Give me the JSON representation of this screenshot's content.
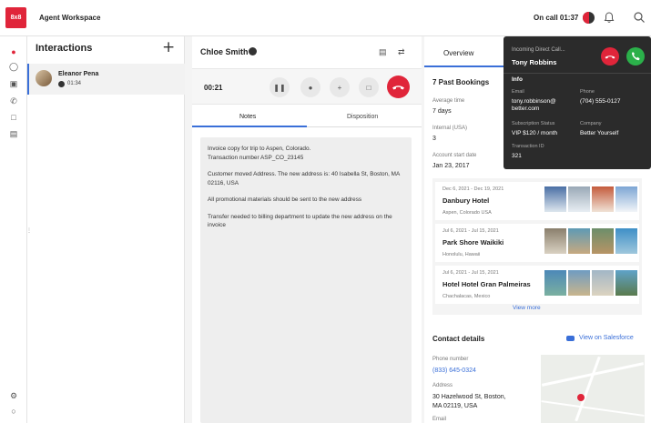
{
  "topbar": {
    "logo": "8x8",
    "app_title": "Agent Workspace",
    "oncall_label": "On call 01:37"
  },
  "icons": {
    "bell": "bell-icon",
    "search": "search-icon",
    "presence": "presence-avatar-icon"
  },
  "leftnav": {
    "items": [
      "headset-icon",
      "chat-icon",
      "voicemail-icon",
      "phone-icon",
      "folder-icon",
      "contacts-icon"
    ],
    "bottom": [
      "settings-icon",
      "help-icon"
    ]
  },
  "interactions": {
    "title": "Interactions",
    "add_label": "+",
    "items": [
      {
        "name": "Eleanor Pena",
        "time": "01:34"
      }
    ]
  },
  "call": {
    "caller_name": "Chloe Smith",
    "timer": "00:21",
    "tabs": [
      "Notes",
      "Disposition"
    ],
    "notes": [
      "Invoice copy for trip to Aspen, Colorado.\nTransaction number ASP_CO_23145",
      "Customer moved Address. The new address is: 40 Isabella St, Boston, MA 02116, USA",
      "All promotional materials should be sent to the new address",
      "Transfer needed to billing department to update the new address on the invoice"
    ]
  },
  "overview": {
    "tab": "Overview",
    "bookings_title": "7 Past Bookings",
    "avg_time_label": "Average time",
    "avg_time_value": "7 days",
    "internal_label": "Internal (USA)",
    "internal_value": "3",
    "start_label": "Account start date",
    "start_value": "Jan 23, 2017",
    "bookings": [
      {
        "dates": "Dec 6, 2021 - Dec 19, 2021",
        "name": "Danbury Hotel",
        "location": "Aspen, Colorado USA"
      },
      {
        "dates": "Jul 6, 2021 - Jul 15, 2021",
        "name": "Park Shore Waikiki",
        "location": "Honolulu, Hawaii"
      },
      {
        "dates": "Jul 6, 2021 - Jul 15, 2021",
        "name": "Hotel Hotel Gran Palmeiras",
        "location": "Chachalacas, Mexico"
      }
    ],
    "view_more": "View more",
    "contact_title": "Contact details",
    "salesforce_link": "View on Salesforce",
    "phone_label": "Phone number",
    "phone_value": "(833) 645-0324",
    "address_label": "Address",
    "address_value": "30 Hazelwood St, Boston,\nMA 02119, USA",
    "email_label": "Email"
  },
  "popup": {
    "incoming": "Incoming Direct Call...",
    "caller": "Tony Robbins",
    "info_title": "Info",
    "email_label": "Email",
    "email_value": "tony.robbinson@\nbetter.com",
    "phone_label": "Phone",
    "phone_value": "(704) 555-0127",
    "sub_label": "Subscription Status",
    "sub_value": "VIP $120 / month",
    "company_label": "Company",
    "company_value": "Better Yourself",
    "txn_label": "Transaction ID",
    "txn_value": "321"
  },
  "colors": {
    "brand": "#e0253a",
    "accent": "#3a6fd8",
    "accept": "#2bb04a"
  }
}
